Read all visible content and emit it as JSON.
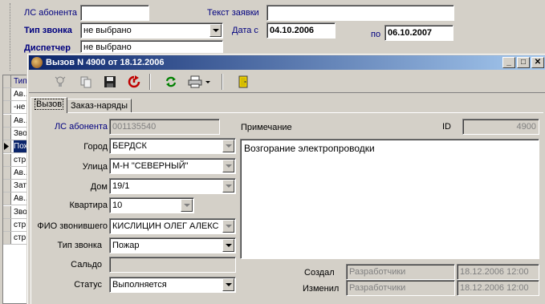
{
  "filter": {
    "ls_label": "ЛС абонента",
    "ls_value": "",
    "type_label": "Тип звонка",
    "type_value": "не выбрано",
    "text_label": "Текст заявки",
    "text_value": "",
    "date_from_label": "Дата с",
    "date_from_value": "04.10.2006",
    "date_to_label": "по",
    "date_to_value": "06.10.2007",
    "dispatcher_label": "Диспетчер",
    "dispatcher_value": "не выбрано"
  },
  "grid": {
    "header": "Тип",
    "rows": [
      "Ав...",
      "-не",
      "Ав...",
      "Зво",
      "Пож",
      "стр",
      "Ав...",
      "Зат",
      "Ав...",
      "Зво",
      "стр",
      "стр"
    ],
    "selected_index": 4
  },
  "window": {
    "title": "Вызов N 4900 от 18.12.2006",
    "minimize": "_",
    "maximize": "□",
    "close": "✕"
  },
  "toolbar": {
    "icons": [
      "bulb-off-icon",
      "copy-icon",
      "save-icon",
      "cancel-icon",
      "refresh-icon",
      "print-icon",
      "print-dropdown-icon",
      "exit-door-icon"
    ]
  },
  "tabs": [
    {
      "label": "Вызов",
      "active": true
    },
    {
      "label": "Заказ-наряды",
      "active": false
    }
  ],
  "form": {
    "ls_label": "ЛС абонента",
    "ls_value": "001135540",
    "city_label": "Город",
    "city_value": "БЕРДСК",
    "street_label": "Улица",
    "street_value": "М-Н \"СЕВЕРНЫЙ\"",
    "house_label": "Дом",
    "house_value": "19/1",
    "flat_label": "Квартира",
    "flat_value": "10",
    "caller_label": "ФИО звонившего",
    "caller_value": "КИСЛИЦИН  ОЛЕГ АЛЕКС",
    "type_label": "Тип звонка",
    "type_value": "Пожар",
    "balance_label": "Сальдо",
    "balance_value": "",
    "status_label": "Статус",
    "status_value": "Выполняется",
    "note_label": "Примечание",
    "note_value": "Возгорание электропроводки",
    "id_label": "ID",
    "id_value": "4900",
    "created_label": "Создал",
    "created_by": "Разработчики",
    "created_at": "18.12.2006 12:00",
    "modified_label": "Изменил",
    "modified_by": "Разработчики",
    "modified_at": "18.12.2006 12:00"
  },
  "colors": {
    "titlebar_start": "#0a246a",
    "titlebar_end": "#a6caf0",
    "label_blue": "#00007f",
    "face": "#d4d0c8"
  }
}
